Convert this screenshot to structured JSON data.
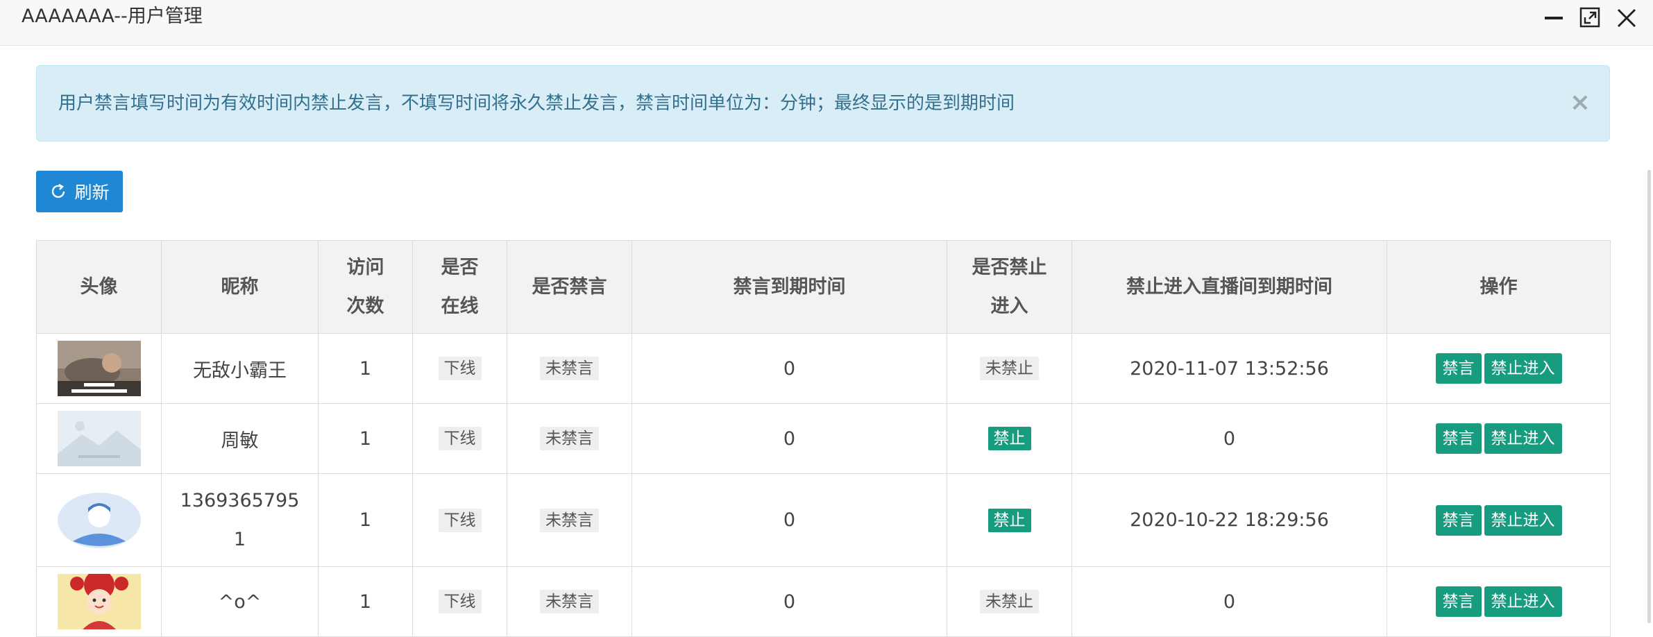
{
  "window": {
    "title": "AAAAAAA--用户管理",
    "minimize_icon": "minimize-icon",
    "maximize_icon": "maximize-icon",
    "close_icon": "close-icon"
  },
  "alert": {
    "text": "用户禁言填写时间为有效时间内禁止发言，不填写时间将永久禁止发言，禁言时间单位为：分钟；最终显示的是到期时间",
    "close_label": "×"
  },
  "toolbar": {
    "refresh_label": "刷新",
    "refresh_icon": "refresh-icon",
    "accent": "#1e88d4"
  },
  "table": {
    "headers": {
      "avatar": "头像",
      "nickname": "昵称",
      "visits_1": "访问",
      "visits_2": "次数",
      "online_1": "是否",
      "online_2": "在线",
      "muted": "是否禁言",
      "mute_expiry": "禁言到期时间",
      "banned_1": "是否禁止",
      "banned_2": "进入",
      "ban_expiry": "禁止进入直播间到期时间",
      "actions": "操作"
    },
    "rows": [
      {
        "avatar": "meme-photo",
        "nickname": "无敌小霸王",
        "nickname_2": "",
        "visits": "1",
        "online": "下线",
        "muted": "未禁言",
        "mute_expiry": "0",
        "banned": "未禁止",
        "ban_expiry": "2020-11-07 13:52:56",
        "mute_btn": "禁言",
        "ban_btn": "禁止进入"
      },
      {
        "avatar": "image-placeholder",
        "nickname": "周敏",
        "nickname_2": "",
        "visits": "1",
        "online": "下线",
        "muted": "未禁言",
        "mute_expiry": "0",
        "banned": "禁止",
        "ban_expiry": "0",
        "mute_btn": "禁言",
        "ban_btn": "禁止进入"
      },
      {
        "avatar": "default-person-avatar",
        "nickname": "1369365795",
        "nickname_2": "1",
        "visits": "1",
        "online": "下线",
        "muted": "未禁言",
        "mute_expiry": "0",
        "banned": "禁止",
        "ban_expiry": "2020-10-22 18:29:56",
        "mute_btn": "禁言",
        "ban_btn": "禁止进入"
      },
      {
        "avatar": "cartoon-avatar",
        "nickname": "^o^",
        "nickname_2": "",
        "visits": "1",
        "online": "下线",
        "muted": "未禁言",
        "mute_expiry": "0",
        "banned": "未禁止",
        "ban_expiry": "0",
        "mute_btn": "禁言",
        "ban_btn": "禁止进入"
      }
    ]
  },
  "colors": {
    "green": "#179c7f",
    "alert_bg": "#d9edf7",
    "alert_text": "#31708f"
  }
}
